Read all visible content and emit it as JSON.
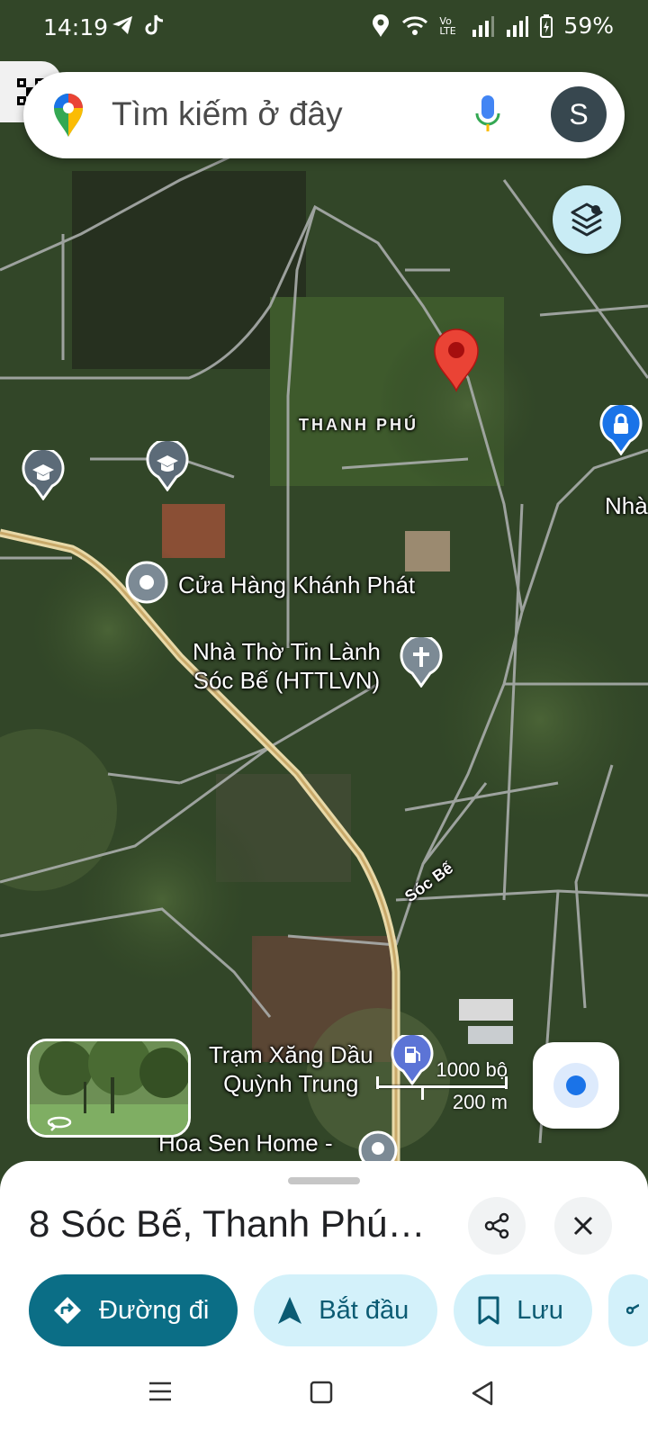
{
  "status_bar": {
    "time": "14:19",
    "network": "Vo LTE",
    "battery": "59%"
  },
  "search": {
    "placeholder": "Tìm kiếm ở đây",
    "avatar_initial": "S"
  },
  "map": {
    "area_label": "THANH PHÚ",
    "poi_shop": "Cửa Hàng Khánh Phát",
    "poi_church_line1": "Nhà Thờ Tin Lành",
    "poi_church_line2": "Sóc Bế (HTTLVN)",
    "poi_gas_line1": "Trạm Xăng Dầu",
    "poi_gas_line2": "Quỳnh Trung",
    "poi_home": "Hoa Sen Home -",
    "poi_edge": "Nhà",
    "road_label": "Sóc Bế",
    "scale_feet": "1000 bộ",
    "scale_meters": "200 m"
  },
  "place": {
    "title": "8 Sóc Bế, Thanh Phú…"
  },
  "actions": {
    "directions": "Đường đi",
    "start": "Bắt đầu",
    "save": "Lưu"
  },
  "colors": {
    "primary": "#0b6e86",
    "chip": "#d3f1fa",
    "pin": "#ea4335"
  }
}
